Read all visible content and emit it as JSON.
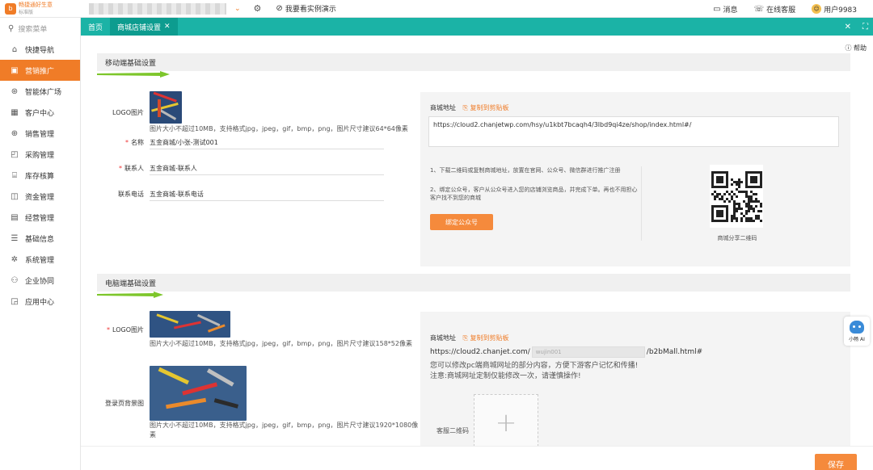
{
  "topbar": {
    "logo_text": "畅捷通好生意",
    "logo_sub": "标准版",
    "demo_label": "我要看实例演示",
    "messages": "消息",
    "online_service": "在线客服",
    "user": "用户9983"
  },
  "sidebar": {
    "search_placeholder": "搜索菜单",
    "items": [
      {
        "label": "快捷导航",
        "icon": "home-icon"
      },
      {
        "label": "营销推广",
        "icon": "briefcase-icon"
      },
      {
        "label": "智能体广场",
        "icon": "robot-icon"
      },
      {
        "label": "客户中心",
        "icon": "calendar-icon"
      },
      {
        "label": "销售管理",
        "icon": "cart-icon"
      },
      {
        "label": "采购管理",
        "icon": "bag-icon"
      },
      {
        "label": "库存核算",
        "icon": "warehouse-icon"
      },
      {
        "label": "资金管理",
        "icon": "wallet-icon"
      },
      {
        "label": "经营管理",
        "icon": "clipboard-icon"
      },
      {
        "label": "基础信息",
        "icon": "list-icon"
      },
      {
        "label": "系统管理",
        "icon": "settings-icon"
      },
      {
        "label": "企业协同",
        "icon": "network-icon"
      },
      {
        "label": "应用中心",
        "icon": "apps-icon"
      }
    ],
    "active_index": 1
  },
  "tabs": {
    "home": "首页",
    "current": "商城店铺设置"
  },
  "main": {
    "help": "帮助",
    "mobile": {
      "section_title": "移动端基础设置",
      "logo_label": "LOGO图片",
      "logo_hint": "图片大小不超过10MB，支持格式jpg，jpeg，gif，bmp，png，图片尺寸建议64*64像素",
      "name_label": "名称",
      "name_value": "五金商城/小张-测试001",
      "contact_label": "联系人",
      "contact_value": "五金商城-联系人",
      "phone_label": "联系电话",
      "phone_value": "五金商城-联系电话",
      "mall_address_label": "商城地址",
      "copy_label": "复制到剪贴板",
      "mall_url": "https://cloud2.chanjetwp.com/hsy/u1kbt7bcaqh4/3lbd9qi4ze/shop/index.html#/",
      "steps": [
        "1、下载二维码或复制商城地址，放置在官网、公众号、微信群进行推广注册",
        "2、绑定公众号，客户从公众号进入您的店铺浏览商品，并完成下单。再也不用担心客户找不到您的商城"
      ],
      "bind_button": "绑定公众号",
      "qr_label": "商城分享二维码"
    },
    "pc": {
      "section_title": "电脑端基础设置",
      "logo_label": "LOGO图片",
      "logo_hint": "图片大小不超过10MB，支持格式jpg，jpeg，gif，bmp，png，图片尺寸建议158*52像素",
      "bg_label": "登录页背景图",
      "bg_hint_1": "图片大小不超过10MB，支持格式jpg，jpeg，gif，bmp，png，图片尺寸建议1920*1080像",
      "bg_hint_2": "素",
      "mall_address_label": "商城地址",
      "copy_label": "复制到剪贴板",
      "url_prefix": "https://cloud2.chanjet.com/",
      "url_input": "wujin001",
      "url_suffix": "/b2bMall.html#",
      "note_1": "您可以修改pc端商城网址的部分内容，方便下游客户记忆和传播!",
      "note_2": "注意:商城网址定制仅能修改一次，请谨慎操作!",
      "service_qr_label": "客服二维码"
    },
    "save_button": "保存",
    "assistant_label": "小畅 AI"
  },
  "colors": {
    "accent": "#f07c27",
    "tab_bar": "#1bb3a6"
  }
}
